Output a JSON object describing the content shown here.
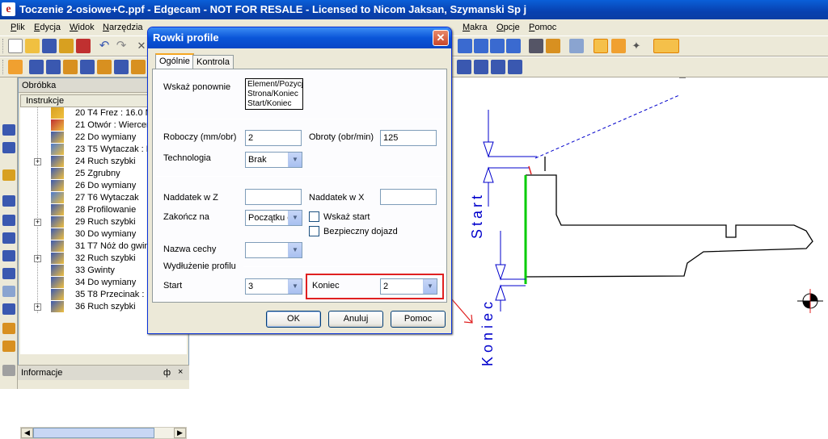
{
  "app": {
    "title": "Toczenie 2-osiowe+C.ppf - Edgecam - NOT FOR RESALE - Licensed to Nicom Jaksan, Szymanski Sp j",
    "icon_letter": "e",
    "brand_color": "#0a52c8"
  },
  "menu": [
    {
      "key": "P",
      "label": "lik"
    },
    {
      "key": "E",
      "label": "dycja"
    },
    {
      "key": "W",
      "label": "idok"
    },
    {
      "key": "N",
      "label": "arzędzia"
    }
  ],
  "menu_right": [
    {
      "key": "M",
      "label": "akra"
    },
    {
      "key": "O",
      "label": "pcje"
    },
    {
      "key": "P",
      "label": "omoc"
    }
  ],
  "panel": {
    "title": "Obróbka",
    "column_header": "Instrukcje",
    "items": [
      {
        "text": "20 T4 Frez : 16.0 M",
        "expand": false,
        "icon": "tool-icon"
      },
      {
        "text": "21 Otwór : Wierceni",
        "expand": false,
        "icon": "drill-icon"
      },
      {
        "text": "22 Do wymiany",
        "expand": false,
        "icon": "tool-change-icon"
      },
      {
        "text": "23 T5 Wytaczak : D",
        "expand": false,
        "icon": "boring-tool-icon"
      },
      {
        "text": "24 Ruch szybki",
        "expand": true,
        "icon": "rapid-move-icon"
      },
      {
        "text": "25 Zgrubny",
        "expand": false,
        "icon": "roughing-icon"
      },
      {
        "text": "26 Do wymiany",
        "expand": false,
        "icon": "tool-change-icon"
      },
      {
        "text": "27 T6 Wytaczak",
        "expand": false,
        "icon": "boring-tool-icon"
      },
      {
        "text": "28 Profilowanie",
        "expand": false,
        "icon": "profiling-icon"
      },
      {
        "text": "29 Ruch szybki",
        "expand": true,
        "icon": "rapid-move-icon"
      },
      {
        "text": "30 Do wymiany",
        "expand": false,
        "icon": "tool-change-icon"
      },
      {
        "text": "31 T7 Nóż do gwint",
        "expand": false,
        "icon": "threading-tool-icon"
      },
      {
        "text": "32 Ruch szybki",
        "expand": true,
        "icon": "rapid-move-icon"
      },
      {
        "text": "33 Gwinty",
        "expand": false,
        "icon": "thread-icon"
      },
      {
        "text": "34 Do wymiany",
        "expand": false,
        "icon": "tool-change-icon"
      },
      {
        "text": "35 T8 Przecinak : 3",
        "expand": false,
        "icon": "parting-tool-icon"
      },
      {
        "text": "36 Ruch szybki",
        "expand": true,
        "icon": "rapid-move-icon"
      }
    ],
    "info_title": "Informacje",
    "info_pin": "ф",
    "info_close": "×"
  },
  "dialog": {
    "title": "Rowki profile",
    "close": "✕",
    "tabs": [
      "Ogólnie",
      "Kontrola"
    ],
    "wskaz_label": "Wskaż ponownie",
    "wskaz_items": [
      "Element/Pozycj",
      "Strona/Koniec",
      "Start/Koniec"
    ],
    "roboczy_label": "Roboczy (mm/obr)",
    "roboczy_value": "2",
    "obroty_label": "Obroty (obr/min)",
    "obroty_value": "125",
    "technologia_label": "Technologia",
    "technologia_value": "Brak",
    "naddatek_z_label": "Naddatek w Z",
    "naddatek_z_value": "",
    "naddatek_x_label": "Naddatek w X",
    "naddatek_x_value": "",
    "zakoncz_label": "Zakończ na",
    "zakoncz_value": "Początku c",
    "wskaz_start_label": "Wskaż start",
    "bezpieczny_label": "Bezpieczny dojazd",
    "nazwa_label": "Nazwa cechy",
    "nazwa_value": "",
    "wydluzenie_label": "Wydłużenie profilu",
    "start_label": "Start",
    "start_value": "3",
    "koniec_label": "Koniec",
    "koniec_value": "2",
    "ok": "OK",
    "cancel": "Anuluj",
    "help": "Pomoc",
    "highlight_color": "#e02020"
  },
  "drawing": {
    "start_label": "Start",
    "koniec_label": "Koniec",
    "profile_color": "#000000",
    "highlight_color": "#00cc00",
    "dim_color": "#0000cc",
    "arrow_color": "#e02020"
  }
}
